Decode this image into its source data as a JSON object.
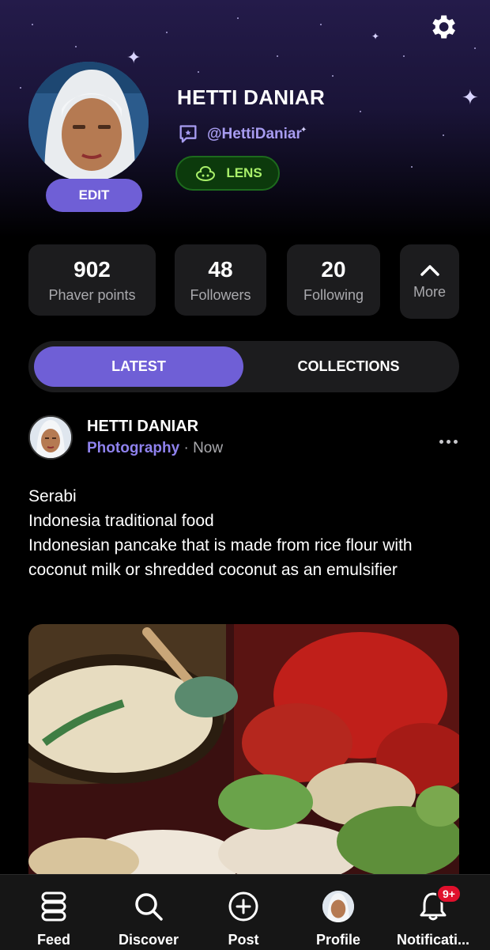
{
  "profile": {
    "name": "HETTI DANIAR",
    "handle": "@HettiDaniar",
    "edit_label": "EDIT",
    "badge_label": "LENS"
  },
  "stats": [
    {
      "value": "902",
      "label": "Phaver points"
    },
    {
      "value": "48",
      "label": "Followers"
    },
    {
      "value": "20",
      "label": "Following"
    }
  ],
  "more_label": "More",
  "tabs": {
    "latest": "LATEST",
    "collections": "COLLECTIONS"
  },
  "post": {
    "author": "HETTI DANIAR",
    "category": "Photography",
    "separator": "·",
    "time": "Now",
    "lines": [
      "Serabi",
      "Indonesia traditional food",
      "Indonesian pancake that is made from rice flour with coconut milk or shredded coconut as an emulsifier"
    ]
  },
  "nav": {
    "feed": "Feed",
    "discover": "Discover",
    "post": "Post",
    "profile": "Profile",
    "notifications": "Notificati...",
    "notifications_badge": "9+"
  },
  "colors": {
    "accent": "#6f5fd6",
    "handle": "#a79cf0",
    "lens_bg": "#0c3a0c",
    "lens_text": "#a9f06a",
    "badge_red": "#e0102c"
  },
  "icons": {
    "settings": "gear-icon",
    "handle": "chat-bubble-icon",
    "lens": "lens-leaf-icon",
    "more": "chevron-up-icon",
    "feed": "feed-stack-icon",
    "discover": "search-icon",
    "post": "plus-circle-icon",
    "notifications": "bell-icon"
  }
}
